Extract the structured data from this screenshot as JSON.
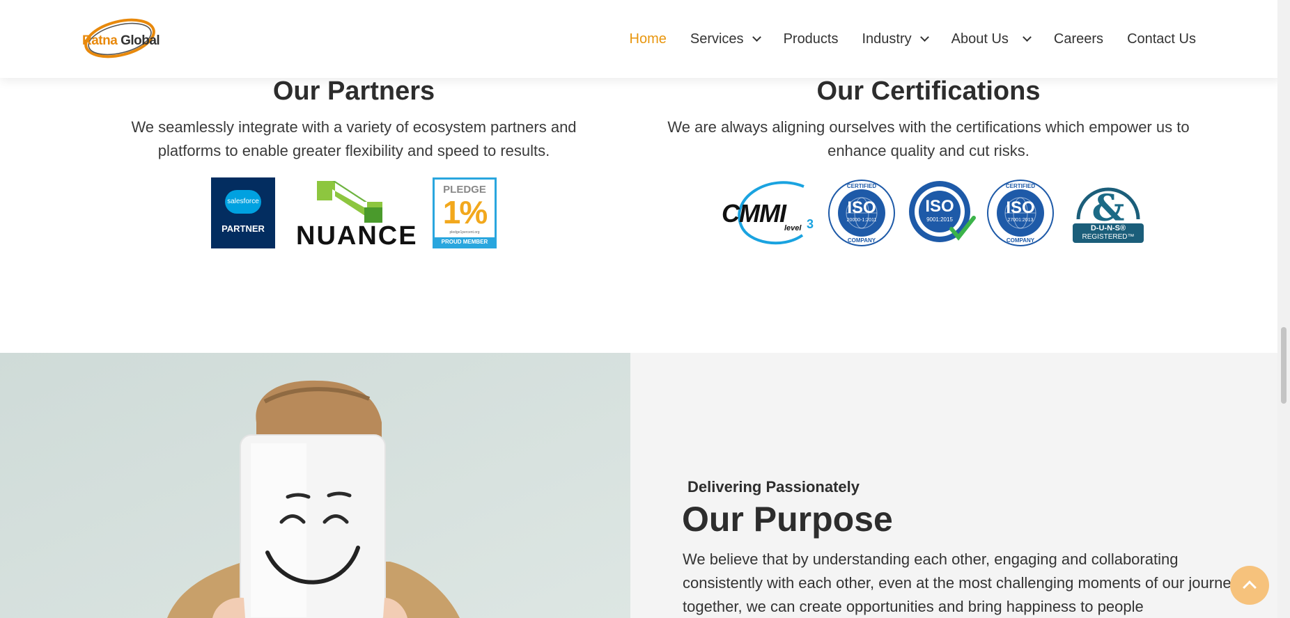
{
  "header": {
    "logo": {
      "brand_first": "Ratna",
      "brand_second": "Global"
    },
    "nav": [
      {
        "label": "Home",
        "active": true,
        "dropdown": false
      },
      {
        "label": "Services",
        "dropdown": true
      },
      {
        "label": "Products",
        "dropdown": false
      },
      {
        "label": "Industry",
        "dropdown": true
      },
      {
        "label": "About Us",
        "dropdown": true
      },
      {
        "label": "Careers",
        "dropdown": false
      },
      {
        "label": "Contact Us",
        "dropdown": false
      }
    ],
    "accent_color": "#e8960e"
  },
  "partners": {
    "title": "Our Partners",
    "description": "We seamlessly integrate with a variety of ecosystem partners and platforms to enable greater flexibility and speed to results.",
    "logos": {
      "salesforce": {
        "brand": "salesforce",
        "label": "PARTNER"
      },
      "nuance": {
        "label": "NUANCE"
      },
      "pledge": {
        "line1": "PLEDGE",
        "line2": "1%",
        "line3": "pledge1percent.org",
        "line4": "PROUD MEMBER"
      }
    }
  },
  "certifications": {
    "title": "Our Certifications",
    "description": "We are always aligning ourselves with the certifications which empower us to enhance quality and cut risks.",
    "logos": {
      "cmmi": {
        "label": "CMMI",
        "level": "level",
        "level_number": "3"
      },
      "iso1": {
        "top": "CERTIFIED",
        "center": "ISO",
        "standard": "20000-1:2011",
        "bottom": "COMPANY"
      },
      "iso2": {
        "center": "ISO",
        "standard": "9001:2015"
      },
      "iso3": {
        "top": "CERTIFIED",
        "center": "ISO",
        "standard": "27001:2013",
        "bottom": "COMPANY"
      },
      "duns": {
        "arc": "DUN & BRADSTREET",
        "line1": "D-U-N-S®",
        "line2": "REGISTERED™"
      }
    }
  },
  "purpose": {
    "eyebrow": "Delivering Passionately",
    "title": "Our Purpose",
    "body": "We believe that by understanding each other, engaging and collaborating consistently with each other, even at the most challenging moments of our journey together, we can create opportunities and bring happiness to people"
  },
  "icons": {
    "back_to_top": "chevron-up-icon"
  }
}
